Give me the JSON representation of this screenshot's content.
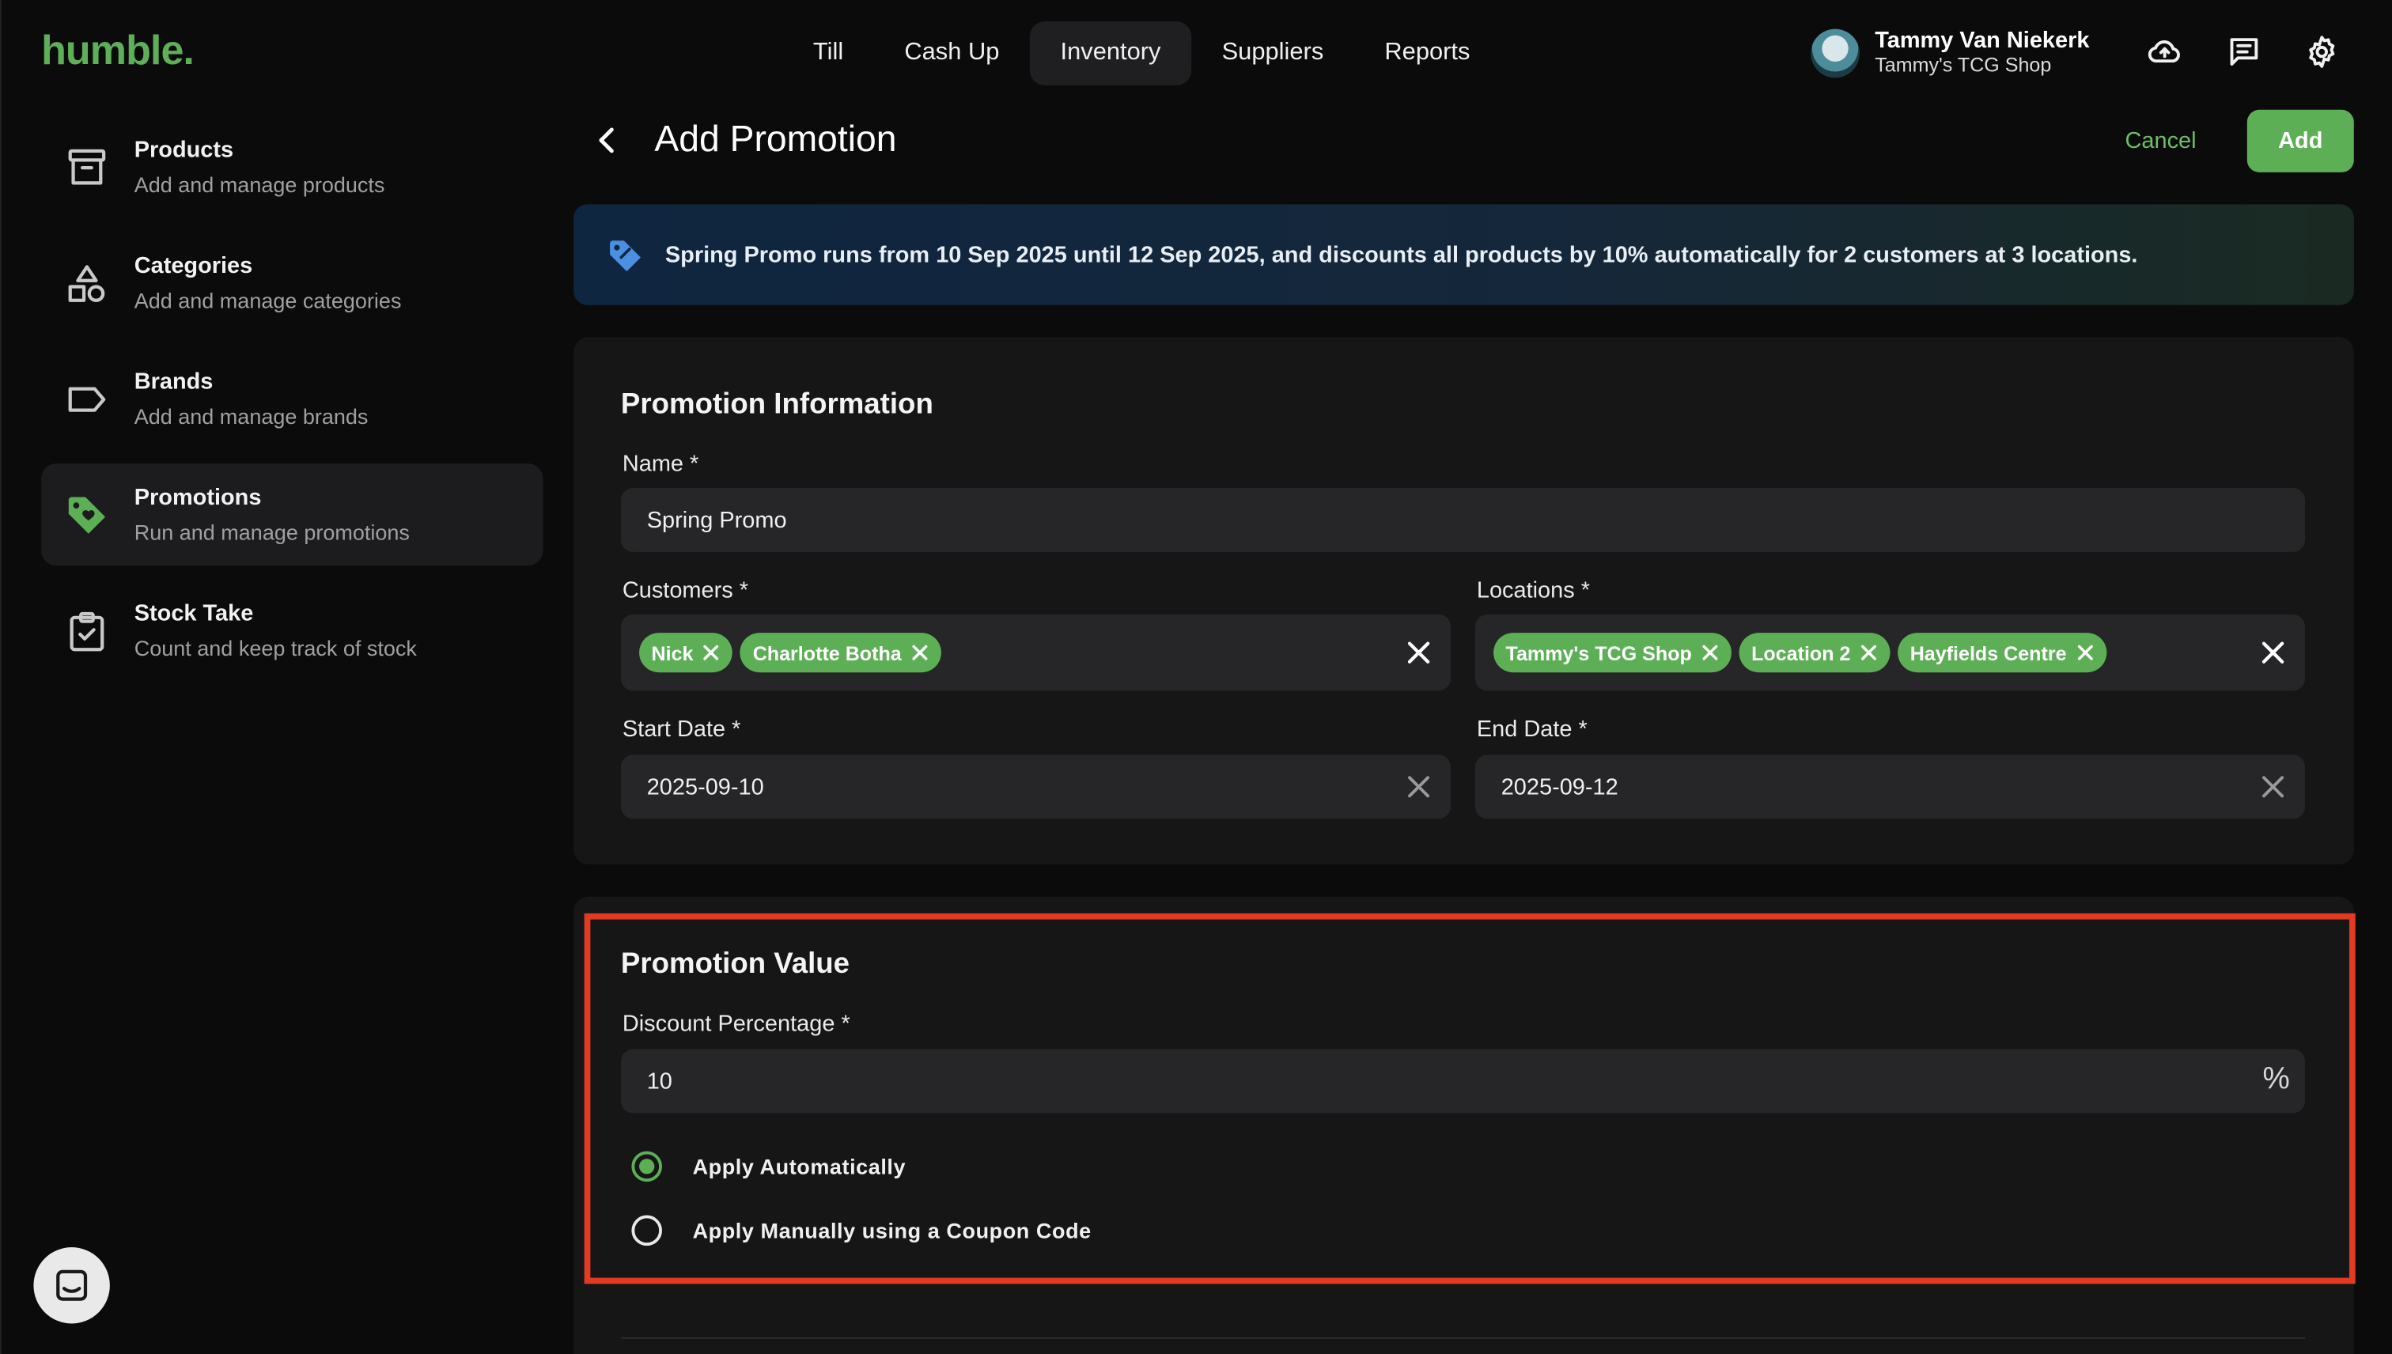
{
  "brand": {
    "logo": "humble."
  },
  "topnav": [
    "Till",
    "Cash Up",
    "Inventory",
    "Suppliers",
    "Reports"
  ],
  "user": {
    "name": "Tammy Van Niekerk",
    "shop": "Tammy's TCG Shop"
  },
  "sidebar": {
    "items": [
      {
        "title": "Products",
        "subtitle": "Add and manage products"
      },
      {
        "title": "Categories",
        "subtitle": "Add and manage categories"
      },
      {
        "title": "Brands",
        "subtitle": "Add and manage brands"
      },
      {
        "title": "Promotions",
        "subtitle": "Run and manage promotions"
      },
      {
        "title": "Stock Take",
        "subtitle": "Count and keep track of stock"
      }
    ]
  },
  "header": {
    "title": "Add Promotion",
    "cancel": "Cancel",
    "add": "Add"
  },
  "banner": {
    "text": "Spring Promo runs from 10 Sep 2025 until 12 Sep 2025, and discounts all products by 10% automatically for 2 customers at 3 locations."
  },
  "info": {
    "title": "Promotion Information",
    "name_label": "Name *",
    "name_value": "Spring Promo",
    "customers_label": "Customers *",
    "customers": [
      "Nick",
      "Charlotte Botha"
    ],
    "locations_label": "Locations *",
    "locations": [
      "Tammy's TCG Shop",
      "Location 2",
      "Hayfields Centre"
    ],
    "start_label": "Start Date *",
    "start_value": "2025-09-10",
    "end_label": "End Date *",
    "end_value": "2025-09-12"
  },
  "value": {
    "title": "Promotion Value",
    "discount_label": "Discount Percentage *",
    "discount_value": "10",
    "discount_unit": "%",
    "apply_auto": "Apply Automatically",
    "apply_manual": "Apply Manually using a Coupon Code",
    "selected": "auto"
  },
  "colors": {
    "accent": "#5daf56",
    "highlight": "#e33b23",
    "banner": "#0f2640"
  }
}
